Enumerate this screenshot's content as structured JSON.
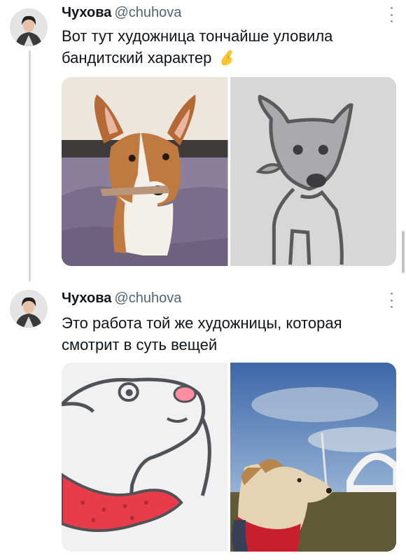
{
  "tweets": [
    {
      "author_name": "Чухова",
      "author_handle": "@chuhova",
      "text": "Вот тут художница тончайше уловила бандитский характер",
      "emoji": "pinching-hand-icon",
      "media": [
        {
          "icon": "corgi-photo"
        },
        {
          "icon": "dog-drawing"
        }
      ]
    },
    {
      "author_name": "Чухова",
      "author_handle": "@chuhova",
      "text": "Это работа той же художницы, которая смотрит в суть вещей",
      "media": [
        {
          "icon": "dog-profile-drawing"
        },
        {
          "icon": "terrier-photo"
        }
      ]
    }
  ],
  "colors": {
    "text": "#0f1419",
    "handle": "#536471",
    "thread_line": "#cfd9de",
    "bandana": "#e8434a",
    "nose": "#f4a0ad"
  }
}
